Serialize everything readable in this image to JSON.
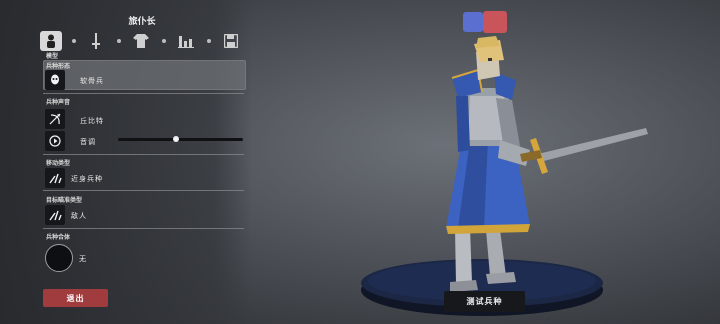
{
  "header": {
    "title": "旅仆长"
  },
  "tabs": [
    {
      "name": "model",
      "icon": "person-icon",
      "active": true
    },
    {
      "name": "weapon",
      "icon": "sword-icon",
      "active": false
    },
    {
      "name": "armor",
      "icon": "shirt-icon",
      "active": false
    },
    {
      "name": "stats",
      "icon": "bar-chart-icon",
      "active": false
    },
    {
      "name": "save",
      "icon": "floppy-disk-icon",
      "active": false
    }
  ],
  "sections": {
    "model": {
      "label": "模型"
    },
    "form": {
      "label": "兵种形态",
      "value": "软骨兵"
    },
    "voice": {
      "label": "兵种声音",
      "value": "丘比特",
      "pitch_label": "音调",
      "pitch_value": 0.46
    },
    "movement": {
      "label": "移动类型",
      "value": "近身兵种"
    },
    "targeting": {
      "label": "目标瞄准类型",
      "value": "敌人"
    },
    "combine": {
      "label": "兵种合体",
      "value": "无"
    }
  },
  "footer": {
    "exit_label": "退出"
  },
  "preview": {
    "test_label": "测试兵种",
    "team_colors": [
      "#5a6fd0",
      "#c9545a"
    ]
  },
  "colors": {
    "exit": "#a03b3e",
    "accent_blue": "#3a5fb8",
    "gold": "#d6a63c"
  }
}
